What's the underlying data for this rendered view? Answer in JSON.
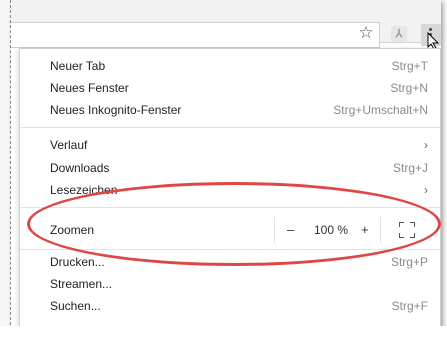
{
  "menu": {
    "items_top": [
      {
        "label": "Neuer Tab",
        "shortcut": "Strg+T"
      },
      {
        "label": "Neues Fenster",
        "shortcut": "Strg+N"
      },
      {
        "label": "Neues Inkognito-Fenster",
        "shortcut": "Strg+Umschalt+N"
      }
    ],
    "items_mid": [
      {
        "label": "Verlauf",
        "shortcut": ""
      },
      {
        "label": "Downloads",
        "shortcut": "Strg+J"
      },
      {
        "label": "Lesezeichen",
        "shortcut": ""
      }
    ],
    "zoom": {
      "label": "Zoomen",
      "minus": "–",
      "value": "100 %",
      "plus": "+"
    },
    "items_bottom": [
      {
        "label": "Drucken...",
        "shortcut": "Strg+P"
      },
      {
        "label": "Streamen...",
        "shortcut": ""
      },
      {
        "label": "Suchen...",
        "shortcut": "Strg+F"
      }
    ]
  },
  "toolbar": {
    "star_icon": "star-icon",
    "pdf_icon": "pdf-icon",
    "menu_icon": "three-dots-menu-icon"
  },
  "colors": {
    "highlight": "#e04646"
  }
}
